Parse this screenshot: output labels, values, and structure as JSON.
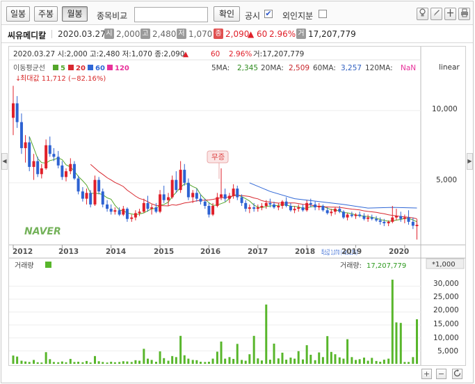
{
  "toolbar": {
    "period_buttons": [
      "일봉",
      "주봉",
      "월봉"
    ],
    "active_period": "월봉",
    "compare_label": "종목비교",
    "search_value": "",
    "confirm_label": "확인",
    "disclosure_label": "공시",
    "disclosure_checked": "✔",
    "foreign_label": "외인지분",
    "foreign_checked": "",
    "icons": [
      "bulb-icon",
      "pen-icon",
      "crosshair-icon",
      "print-icon"
    ]
  },
  "info": {
    "name": "씨유메디칼",
    "date": "2020.03.27",
    "badges": [
      {
        "badge": "시",
        "value": "2,000",
        "tone": "gray"
      },
      {
        "badge": "고",
        "value": "2,480",
        "tone": "gray"
      },
      {
        "badge": "저",
        "value": "1,070",
        "tone": "gray"
      },
      {
        "badge": "종",
        "value": "2,090",
        "tone": "red"
      },
      {
        "badge": "거",
        "value": "17,207,779",
        "tone": "dark"
      }
    ],
    "change": "▲ 60",
    "change_pct": "2.96%"
  },
  "chart": {
    "header_line": "2020.03.27 시:2,000 고:2,480 저:1,070 종:2,090",
    "header_arrow": "▲",
    "header_change": "60",
    "header_pct": "2.96%",
    "header_volume": "거:17,207,779",
    "ma_title": "이동평균선",
    "ma_legend": [
      {
        "label": "5",
        "color": "#54a62b"
      },
      {
        "label": "20",
        "color": "#d8282f"
      },
      {
        "label": "60",
        "color": "#2f67d6"
      },
      {
        "label": "120",
        "color": "#e8319a"
      }
    ],
    "ma_values": [
      {
        "label": "5MA:",
        "value": "2,345",
        "color": "#2e8b1f"
      },
      {
        "label": "20MA:",
        "value": "2,509",
        "color": "#c8262c"
      },
      {
        "label": "60MA:",
        "value": "3,257",
        "color": "#2f5fc0"
      },
      {
        "label": "120MA:",
        "value": "NaN",
        "color": "#e8319a"
      }
    ],
    "scale_label": "linear",
    "max_label": "최대값 11,712 (−82.16%)",
    "min_label": "최소값 1,070 (+95.33%)",
    "event_label": "무증",
    "watermark": "NAVER",
    "y_ticks": [
      "10,000",
      "5,000"
    ],
    "x_ticks": [
      "2012",
      "2013",
      "2014",
      "2015",
      "2016",
      "2017",
      "2018",
      "2019",
      "2020"
    ],
    "volume_title": "거래량",
    "volume_label": "거래량:",
    "volume_value": "17,207,779",
    "volume_unit": "*1,000",
    "volume_ticks": [
      "30,000",
      "25,000",
      "20,000",
      "15,000",
      "10,000",
      "5,000"
    ],
    "colors": {
      "up": "#e0202a",
      "down": "#2d62d2",
      "vol": "#58b62b",
      "ma5": "#54a62b",
      "ma20": "#d8282f",
      "ma60": "#2f67d6"
    }
  },
  "chart_data": {
    "type": "candlestick",
    "ylim": [
      800,
      12500
    ],
    "y_ticks": [
      5000,
      10000
    ],
    "x_range": [
      2012.0,
      2020.3
    ],
    "candles": [
      [
        2012.0,
        9500,
        11712,
        8300,
        10500
      ],
      [
        2012.08,
        10500,
        11000,
        8800,
        9200
      ],
      [
        2012.17,
        9200,
        9800,
        7000,
        7400
      ],
      [
        2012.25,
        7400,
        8300,
        6400,
        7800
      ],
      [
        2012.33,
        7800,
        8200,
        5800,
        6100
      ],
      [
        2012.42,
        6100,
        7000,
        5200,
        6500
      ],
      [
        2012.5,
        6500,
        6800,
        5400,
        5600
      ],
      [
        2012.58,
        5600,
        6300,
        5300,
        6000
      ],
      [
        2012.67,
        6000,
        8000,
        5900,
        7600
      ],
      [
        2012.75,
        7600,
        8200,
        6800,
        7000
      ],
      [
        2012.83,
        7000,
        7400,
        6500,
        6800
      ],
      [
        2012.92,
        6800,
        7200,
        6000,
        6200
      ],
      [
        2013.0,
        6200,
        6500,
        5200,
        5400
      ],
      [
        2013.08,
        5400,
        6000,
        5100,
        5800
      ],
      [
        2013.17,
        5800,
        6700,
        5600,
        6300
      ],
      [
        2013.25,
        6300,
        6500,
        5200,
        5300
      ],
      [
        2013.33,
        5300,
        5500,
        4200,
        4400
      ],
      [
        2013.42,
        4400,
        4700,
        3700,
        3900
      ],
      [
        2013.5,
        3900,
        4600,
        3500,
        4300
      ],
      [
        2013.58,
        4300,
        4500,
        3300,
        3500
      ],
      [
        2013.67,
        3500,
        5500,
        3400,
        5200
      ],
      [
        2013.75,
        5200,
        5400,
        4200,
        4400
      ],
      [
        2013.83,
        4400,
        4600,
        3300,
        3500
      ],
      [
        2013.92,
        3500,
        3800,
        3000,
        3200
      ],
      [
        2014.0,
        3200,
        3500,
        2800,
        3000
      ],
      [
        2014.08,
        3000,
        3300,
        2800,
        3100
      ],
      [
        2014.17,
        3100,
        3300,
        2700,
        2800
      ],
      [
        2014.25,
        2800,
        3400,
        2700,
        3200
      ],
      [
        2014.33,
        3200,
        3300,
        2300,
        2500
      ],
      [
        2014.42,
        2500,
        2800,
        2300,
        2600
      ],
      [
        2014.5,
        2600,
        3100,
        2400,
        2900
      ],
      [
        2014.58,
        2900,
        3200,
        2700,
        3000
      ],
      [
        2014.67,
        3000,
        3900,
        2900,
        3600
      ],
      [
        2014.75,
        3600,
        4100,
        3000,
        3200
      ],
      [
        2014.83,
        3200,
        3500,
        2800,
        3300
      ],
      [
        2014.92,
        3300,
        3600,
        2900,
        3000
      ],
      [
        2015.0,
        3000,
        4500,
        2900,
        4200
      ],
      [
        2015.08,
        4200,
        4800,
        3600,
        3800
      ],
      [
        2015.17,
        3800,
        4300,
        3400,
        4000
      ],
      [
        2015.25,
        4000,
        5500,
        3900,
        5200
      ],
      [
        2015.33,
        5200,
        5800,
        4300,
        4500
      ],
      [
        2015.42,
        4500,
        6500,
        4300,
        5900
      ],
      [
        2015.5,
        5900,
        6300,
        4800,
        5000
      ],
      [
        2015.58,
        5000,
        5300,
        3800,
        4000
      ],
      [
        2015.67,
        4000,
        4500,
        3600,
        4300
      ],
      [
        2015.75,
        4300,
        4600,
        3700,
        3900
      ],
      [
        2015.83,
        3900,
        4200,
        3500,
        3700
      ],
      [
        2015.92,
        3700,
        3900,
        3200,
        3400
      ],
      [
        2016.0,
        3400,
        3600,
        2600,
        2800
      ],
      [
        2016.08,
        2800,
        3600,
        2700,
        3400
      ],
      [
        2016.17,
        3400,
        4300,
        3300,
        4000
      ],
      [
        2016.25,
        4000,
        6000,
        3800,
        4200
      ],
      [
        2016.33,
        4200,
        4600,
        3700,
        3900
      ],
      [
        2016.42,
        3900,
        4300,
        3600,
        4100
      ],
      [
        2016.5,
        4100,
        4900,
        3900,
        4600
      ],
      [
        2016.58,
        4600,
        4800,
        3800,
        4000
      ],
      [
        2016.67,
        4000,
        4200,
        3400,
        3600
      ],
      [
        2016.75,
        3600,
        3800,
        3000,
        3200
      ],
      [
        2016.83,
        3200,
        3500,
        2900,
        3300
      ],
      [
        2016.92,
        3300,
        3600,
        3000,
        3200
      ],
      [
        2017.0,
        3200,
        3500,
        3000,
        3300
      ],
      [
        2017.08,
        3300,
        3600,
        3100,
        3400
      ],
      [
        2017.17,
        3400,
        3800,
        3200,
        3600
      ],
      [
        2017.25,
        3600,
        3900,
        3300,
        3500
      ],
      [
        2017.33,
        3500,
        3700,
        3200,
        3300
      ],
      [
        2017.42,
        3300,
        3600,
        3100,
        3400
      ],
      [
        2017.5,
        3400,
        3800,
        3200,
        3700
      ],
      [
        2017.58,
        3700,
        4000,
        3300,
        3400
      ],
      [
        2017.67,
        3400,
        3600,
        3000,
        3100
      ],
      [
        2017.75,
        3100,
        3400,
        2900,
        3200
      ],
      [
        2017.83,
        3200,
        3500,
        3000,
        3300
      ],
      [
        2017.92,
        3300,
        3500,
        3000,
        3100
      ],
      [
        2018.0,
        3100,
        3800,
        3000,
        3600
      ],
      [
        2018.08,
        3600,
        3900,
        3300,
        3500
      ],
      [
        2018.17,
        3500,
        3700,
        3100,
        3300
      ],
      [
        2018.25,
        3300,
        3600,
        3100,
        3400
      ],
      [
        2018.33,
        3400,
        3500,
        3000,
        3100
      ],
      [
        2018.42,
        3100,
        3300,
        2800,
        2900
      ],
      [
        2018.5,
        2900,
        3200,
        2700,
        3000
      ],
      [
        2018.58,
        3000,
        3300,
        2800,
        3200
      ],
      [
        2018.67,
        3200,
        3400,
        2900,
        3000
      ],
      [
        2018.75,
        3000,
        3100,
        2500,
        2600
      ],
      [
        2018.83,
        2600,
        2900,
        2400,
        2800
      ],
      [
        2018.92,
        2800,
        3000,
        2600,
        2700
      ],
      [
        2019.0,
        2700,
        2900,
        2500,
        2800
      ],
      [
        2019.08,
        2800,
        3000,
        2600,
        2700
      ],
      [
        2019.17,
        2700,
        2900,
        2400,
        2500
      ],
      [
        2019.25,
        2500,
        2800,
        2300,
        2600
      ],
      [
        2019.33,
        2600,
        2800,
        2400,
        2500
      ],
      [
        2019.42,
        2500,
        2700,
        2300,
        2400
      ],
      [
        2019.5,
        2400,
        2600,
        2100,
        2300
      ],
      [
        2019.58,
        2300,
        2500,
        2000,
        2200
      ],
      [
        2019.67,
        2200,
        2400,
        2000,
        2300
      ],
      [
        2019.75,
        2300,
        3400,
        2200,
        2600
      ],
      [
        2019.83,
        2600,
        3200,
        2400,
        2700
      ],
      [
        2019.92,
        2700,
        3000,
        2300,
        2500
      ],
      [
        2020.0,
        2500,
        2800,
        2200,
        2600
      ],
      [
        2020.08,
        2600,
        3100,
        2100,
        2300
      ],
      [
        2020.17,
        2300,
        2600,
        1800,
        2030
      ],
      [
        2020.25,
        2000,
        2480,
        1070,
        2090
      ]
    ],
    "volume": [
      [
        2012.0,
        3200
      ],
      [
        2012.08,
        2800
      ],
      [
        2012.17,
        1200
      ],
      [
        2012.25,
        900
      ],
      [
        2012.33,
        700
      ],
      [
        2012.42,
        1500
      ],
      [
        2012.5,
        600
      ],
      [
        2012.58,
        500
      ],
      [
        2012.67,
        4500
      ],
      [
        2012.75,
        1800
      ],
      [
        2012.83,
        700
      ],
      [
        2012.92,
        600
      ],
      [
        2013.0,
        900
      ],
      [
        2013.08,
        600
      ],
      [
        2013.17,
        1900
      ],
      [
        2013.25,
        700
      ],
      [
        2013.33,
        800
      ],
      [
        2013.42,
        600
      ],
      [
        2013.5,
        1100
      ],
      [
        2013.58,
        500
      ],
      [
        2013.67,
        3000
      ],
      [
        2013.75,
        1000
      ],
      [
        2013.83,
        700
      ],
      [
        2013.92,
        500
      ],
      [
        2014.0,
        800
      ],
      [
        2014.08,
        600
      ],
      [
        2014.17,
        700
      ],
      [
        2014.25,
        1000
      ],
      [
        2014.33,
        900
      ],
      [
        2014.42,
        700
      ],
      [
        2014.5,
        1400
      ],
      [
        2014.58,
        1200
      ],
      [
        2014.67,
        5800
      ],
      [
        2014.75,
        2000
      ],
      [
        2014.83,
        1500
      ],
      [
        2014.92,
        800
      ],
      [
        2015.0,
        4800
      ],
      [
        2015.08,
        2200
      ],
      [
        2015.17,
        1200
      ],
      [
        2015.25,
        3000
      ],
      [
        2015.33,
        2600
      ],
      [
        2015.42,
        10800
      ],
      [
        2015.5,
        3300
      ],
      [
        2015.58,
        2000
      ],
      [
        2015.67,
        1500
      ],
      [
        2015.75,
        1400
      ],
      [
        2015.83,
        800
      ],
      [
        2015.92,
        700
      ],
      [
        2016.0,
        800
      ],
      [
        2016.08,
        2000
      ],
      [
        2016.17,
        4700
      ],
      [
        2016.25,
        8600
      ],
      [
        2016.33,
        2000
      ],
      [
        2016.42,
        2600
      ],
      [
        2016.5,
        1900
      ],
      [
        2016.58,
        7700
      ],
      [
        2016.67,
        1500
      ],
      [
        2016.75,
        1200
      ],
      [
        2016.83,
        3700
      ],
      [
        2016.92,
        10800
      ],
      [
        2017.0,
        2100
      ],
      [
        2017.08,
        1300
      ],
      [
        2017.17,
        22900
      ],
      [
        2017.25,
        1600
      ],
      [
        2017.33,
        7800
      ],
      [
        2017.42,
        2100
      ],
      [
        2017.5,
        4300
      ],
      [
        2017.58,
        1600
      ],
      [
        2017.67,
        2400
      ],
      [
        2017.75,
        2000
      ],
      [
        2017.83,
        4900
      ],
      [
        2017.92,
        1700
      ],
      [
        2018.0,
        7200
      ],
      [
        2018.08,
        3500
      ],
      [
        2018.17,
        1400
      ],
      [
        2018.25,
        4400
      ],
      [
        2018.33,
        2600
      ],
      [
        2018.42,
        10700
      ],
      [
        2018.5,
        4600
      ],
      [
        2018.58,
        3700
      ],
      [
        2018.67,
        2500
      ],
      [
        2018.75,
        2000
      ],
      [
        2018.83,
        9500
      ],
      [
        2018.92,
        2600
      ],
      [
        2019.0,
        1500
      ],
      [
        2019.08,
        1800
      ],
      [
        2019.17,
        2400
      ],
      [
        2019.25,
        1200
      ],
      [
        2019.33,
        2300
      ],
      [
        2019.42,
        1100
      ],
      [
        2019.5,
        800
      ],
      [
        2019.58,
        1600
      ],
      [
        2019.67,
        2000
      ],
      [
        2019.75,
        32500
      ],
      [
        2019.83,
        16000
      ],
      [
        2019.92,
        15800
      ],
      [
        2020.0,
        700
      ],
      [
        2020.08,
        700
      ],
      [
        2020.17,
        2600
      ],
      [
        2020.25,
        17208
      ]
    ],
    "volume_ylim": [
      0,
      36000
    ],
    "ma60": [
      [
        2016.83,
        5000
      ],
      [
        2017.25,
        4400
      ],
      [
        2017.75,
        3900
      ],
      [
        2018.25,
        3700
      ],
      [
        2018.75,
        3500
      ],
      [
        2019.25,
        3250
      ],
      [
        2019.75,
        3300
      ],
      [
        2020.25,
        3257
      ]
    ]
  }
}
